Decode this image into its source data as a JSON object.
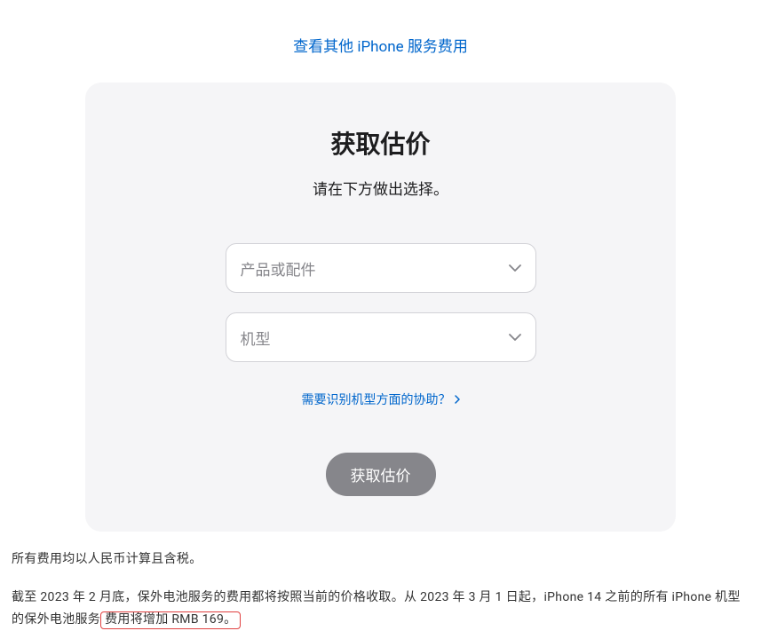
{
  "topLink": {
    "label": "查看其他 iPhone 服务费用"
  },
  "card": {
    "title": "获取估价",
    "subtitle": "请在下方做出选择。",
    "selects": {
      "product": {
        "placeholder": "产品或配件"
      },
      "model": {
        "placeholder": "机型"
      }
    },
    "helpLink": {
      "label": "需要识别机型方面的协助？"
    },
    "submitButton": {
      "label": "获取估价"
    }
  },
  "footer": {
    "line1": "所有费用均以人民币计算且含税。",
    "line2_prefix": "截至 2023 年 2 月底，保外电池服务的费用都将按照当前的价格收取。从 2023 年 3 月 1 日起，iPhone 14 之前的所有 iPhone 机型的保外电池服务",
    "line2_highlighted": "费用将增加 RMB 169。"
  }
}
